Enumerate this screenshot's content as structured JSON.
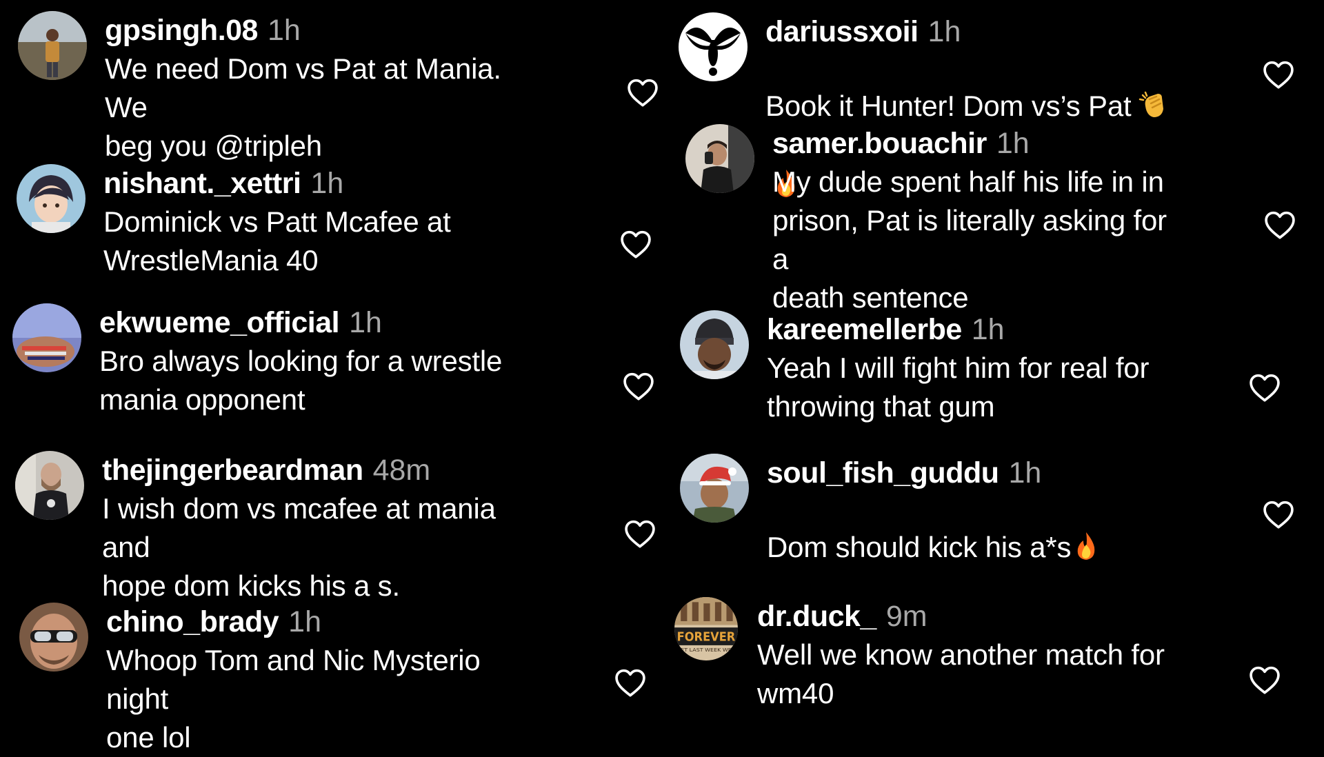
{
  "colors": {
    "background": "#000000",
    "text": "#ffffff",
    "muted": "#a8a8a8"
  },
  "icons": {
    "like": "heart-outline-icon"
  },
  "comments_left": [
    {
      "username": "gpsingh.08",
      "time": "1h",
      "text": "We need Dom vs Pat at Mania. We\nbeg you @tripleh"
    },
    {
      "username": "nishant._xettri",
      "time": "1h",
      "text": "Dominick vs Patt Mcafee at\nWrestleMania 40"
    },
    {
      "username": "ekwueme_official",
      "time": "1h",
      "text": "Bro always looking for a wrestle\nmania opponent"
    },
    {
      "username": "thejingerbeardman",
      "time": "48m",
      "text": "I wish dom vs mcafee at mania and\nhope dom kicks his a s."
    },
    {
      "username": "chino_brady",
      "time": "1h",
      "text": "Whoop Tom and Nic Mysterio night\none lol"
    }
  ],
  "comments_right": [
    {
      "username": "dariussxoii",
      "time": "1h",
      "text": "Book it Hunter! Dom vs’s Pat",
      "emojis": [
        "clapping-hands-emoji",
        "fire-emoji"
      ]
    },
    {
      "username": "samer.bouachir",
      "time": "1h",
      "text": "My dude spent half his life in in\nprison, Pat is literally asking for a\ndeath sentence"
    },
    {
      "username": "kareemellerbe",
      "time": "1h",
      "text": "Yeah I will fight him for real for\nthrowing that gum"
    },
    {
      "username": "soul_fish_guddu",
      "time": "1h",
      "text": "Dom should kick his a*s",
      "emojis": [
        "fire-emoji"
      ]
    },
    {
      "username": "dr.duck_",
      "time": "9m",
      "text": "Well we know another match for\nwm40",
      "avatar_text": {
        "top": "FOREVER",
        "bottom": "ET LAST WEEK WE"
      }
    }
  ]
}
